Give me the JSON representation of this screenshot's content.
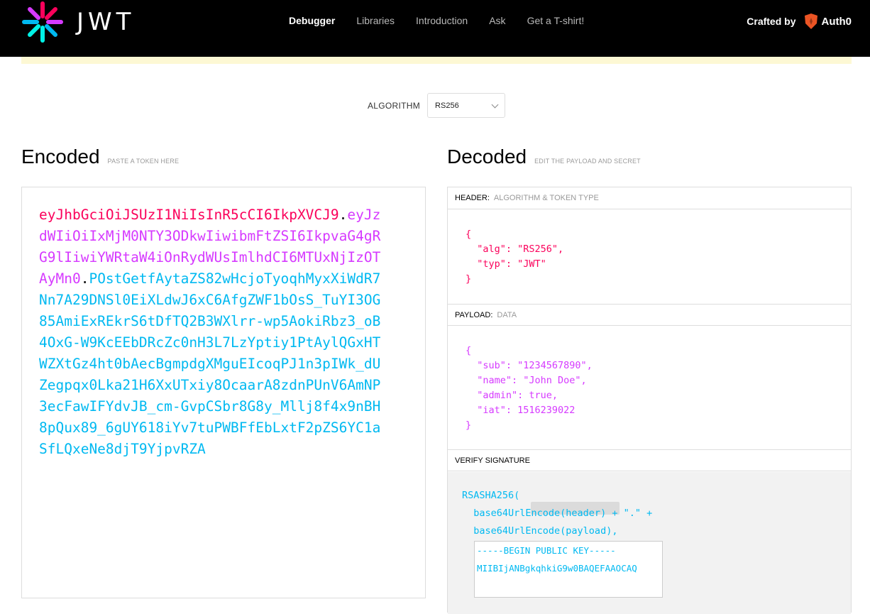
{
  "header": {
    "logo_text": "JWT",
    "nav": [
      "Debugger",
      "Libraries",
      "Introduction",
      "Ask",
      "Get a T-shirt!"
    ],
    "crafted_by": "Crafted by",
    "brand": "Auth0"
  },
  "algorithm": {
    "label": "ALGORITHM",
    "value": "RS256"
  },
  "encoded": {
    "title": "Encoded",
    "subtitle": "PASTE A TOKEN HERE",
    "token_header": "eyJhbGciOiJSUzI1NiIsInR5cCI6IkpXVCJ9",
    "token_payload": "eyJzdWIiOiIxMjM0NTY3ODkwIiwibmFtZSI6IkpvaG4gRG9lIiwiYWRtaW4iOnRydWUsImlhdCI6MTUxNjIzOTAyMn0",
    "token_signature": "POstGetfAytaZS82wHcjoTyoqhMyxXiWdR7Nn7A29DNSl0EiXLdwJ6xC6AfgZWF1bOsS_TuYI3OG85AmiExREkrS6tDfTQ2B3WXlrr-wp5AokiRbz3_oB4OxG-W9KcEEbDRcZc0nH3L7LzYptiy1PtAylQGxHTWZXtGz4ht0bAecBgmpdgXMguEIcoqPJ1n3pIWk_dUZegpqx0Lka21H6XxUTxiy8OcaarA8zdnPUnV6AmNP3ecFawIFYdvJB_cm-GvpCSbr8G8y_Mllj8f4x9nBH8pQux89_6gUY618iYv7tuPWBFfEbLxtF2pZS6YC1aSfLQxeNe8djT9YjpvRZA",
    "dot": "."
  },
  "decoded": {
    "title": "Decoded",
    "subtitle": "EDIT THE PAYLOAD AND SECRET",
    "header_label": "HEADER:",
    "header_desc": "ALGORITHM & TOKEN TYPE",
    "header_json": "{\n  \"alg\": \"RS256\",\n  \"typ\": \"JWT\"\n}",
    "payload_label": "PAYLOAD:",
    "payload_desc": "DATA",
    "payload_json": "{\n  \"sub\": \"1234567890\",\n  \"name\": \"John Doe\",\n  \"admin\": true,\n  \"iat\": 1516239022\n}",
    "verify_label": "VERIFY SIGNATURE",
    "verify_code": "RSASHA256(\n  base64UrlEncode(header) + \".\" +\n  base64UrlEncode(payload),",
    "public_key": "-----BEGIN PUBLIC KEY-----\nMIIBIjANBgkqhkiG9w0BAQEFAAOCAQ"
  },
  "colors": {
    "header": "#fb015b",
    "payload": "#d63aff",
    "signature": "#00b9f1"
  }
}
